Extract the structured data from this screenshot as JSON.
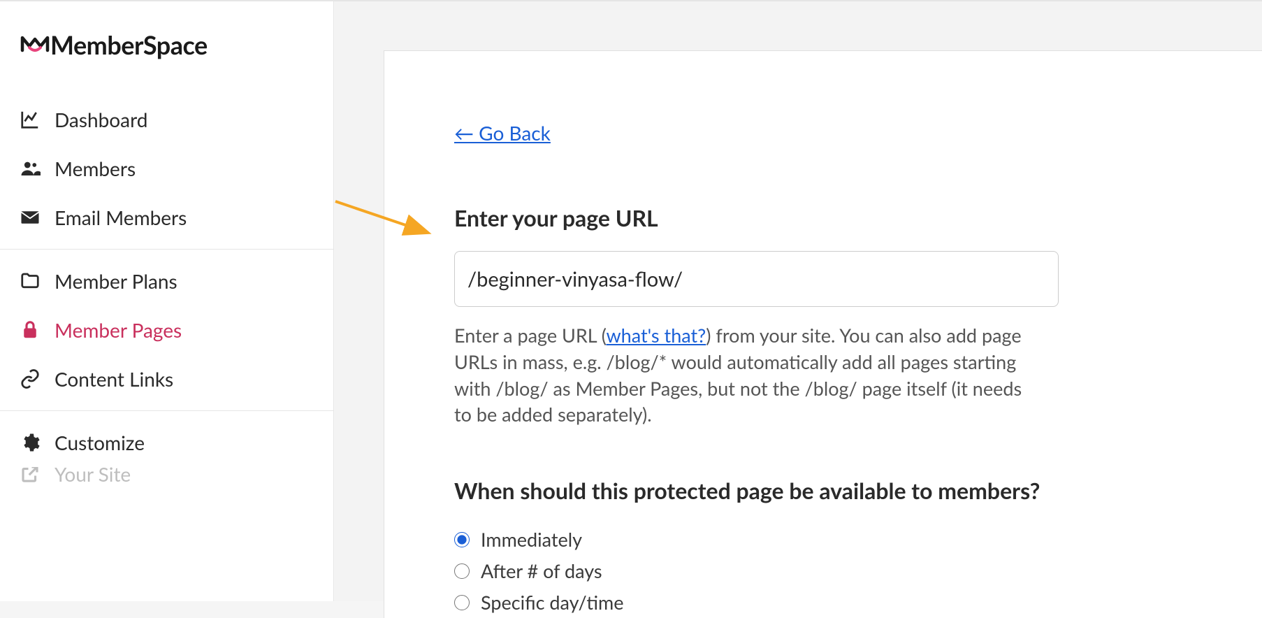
{
  "logo": {
    "text": "MemberSpace"
  },
  "sidebar": {
    "groups": [
      {
        "items": [
          {
            "icon": "chart-icon",
            "label": "Dashboard",
            "active": false
          },
          {
            "icon": "users-icon",
            "label": "Members",
            "active": false
          },
          {
            "icon": "envelope-icon",
            "label": "Email Members",
            "active": false
          }
        ]
      },
      {
        "items": [
          {
            "icon": "folder-icon",
            "label": "Member Plans",
            "active": false
          },
          {
            "icon": "lock-icon",
            "label": "Member Pages",
            "active": true
          },
          {
            "icon": "link-icon",
            "label": "Content Links",
            "active": false
          }
        ]
      },
      {
        "items": [
          {
            "icon": "gear-icon",
            "label": "Customize",
            "active": false
          },
          {
            "icon": "external-icon",
            "label": "Your Site",
            "active": false
          }
        ]
      }
    ]
  },
  "main": {
    "go_back": "← Go Back",
    "url_section": {
      "heading": "Enter your page URL",
      "value": "/beginner-vinyasa-flow/",
      "helper_pre": "Enter a page URL (",
      "helper_link": "what's that?",
      "helper_post": ") from your site. You can also add page URLs in mass, e.g. /blog/* would automatically add all pages starting with /blog/ as Member Pages, but not the /blog/ page itself (it needs to be added separately)."
    },
    "availability_section": {
      "heading": "When should this protected page be available to members?",
      "options": [
        {
          "label": "Immediately",
          "checked": true
        },
        {
          "label": "After # of days",
          "checked": false
        },
        {
          "label": "Specific day/time",
          "checked": false
        }
      ]
    }
  },
  "annotation": {
    "arrow_color": "#f5a623"
  }
}
